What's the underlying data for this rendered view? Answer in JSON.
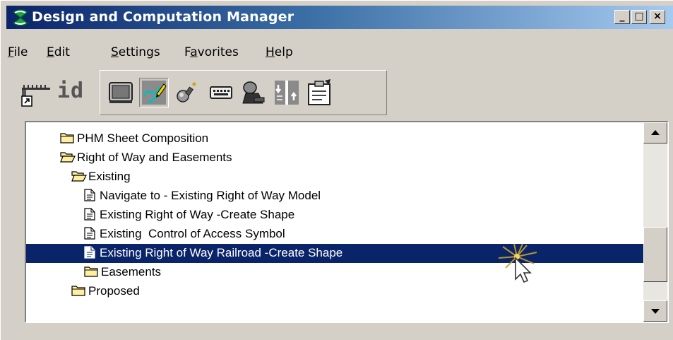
{
  "window": {
    "title": "Design and Computation Manager",
    "buttons": {
      "minimize": "_",
      "maximize": "□",
      "close": "×"
    }
  },
  "menu": {
    "items": [
      {
        "key": "F",
        "rest": "ile"
      },
      {
        "key": "E",
        "rest": "dit"
      },
      {
        "key": "S",
        "rest": "ettings"
      },
      {
        "pre": "F",
        "key": "a",
        "rest": "vorites"
      },
      {
        "key": "H",
        "rest": "elp"
      }
    ]
  },
  "toolbar": {
    "id_label": "id",
    "tools": [
      "monitor-icon",
      "sketch-icon",
      "wand-icon",
      "keyboard-icon",
      "projector-icon",
      "split-icon",
      "clipboard-icon"
    ],
    "active_tool": "sketch-icon"
  },
  "tree": {
    "nodes": [
      {
        "label": "PHM Sheet Composition",
        "type": "folder-closed",
        "depth": 1
      },
      {
        "label": "Right of Way and Easements",
        "type": "folder-open",
        "depth": 1
      },
      {
        "label": "Existing",
        "type": "folder-open",
        "depth": 2
      },
      {
        "label": "Navigate to - Existing Right of Way Model",
        "type": "document",
        "depth": 3
      },
      {
        "label": "Existing Right of Way -Create Shape",
        "type": "document",
        "depth": 3
      },
      {
        "label": "Existing  Control of Access Symbol",
        "type": "document",
        "depth": 3
      },
      {
        "label": "Existing Right of Way Railroad -Create Shape",
        "type": "document",
        "depth": 3,
        "selected": true
      },
      {
        "label": "Easements",
        "type": "folder-closed",
        "depth": 3
      },
      {
        "label": "Proposed",
        "type": "folder-closed",
        "depth": 2
      }
    ]
  },
  "colors": {
    "title_start": "#0a246a",
    "title_end": "#a6caf0",
    "selection": "#0a246a",
    "face": "#d4d0c8"
  }
}
